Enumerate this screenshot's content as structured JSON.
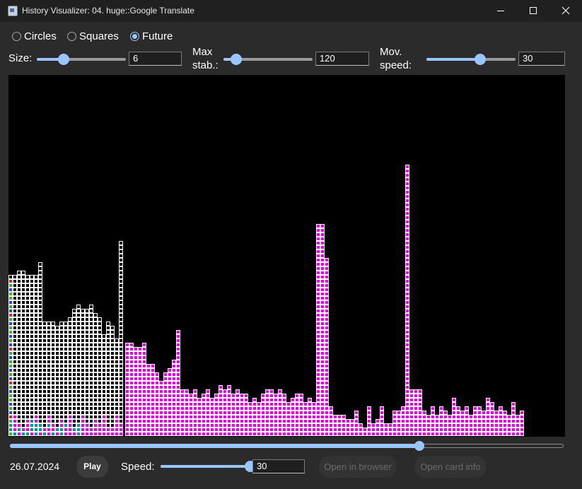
{
  "window": {
    "title": "History Visualizer: 04. huge::Google Translate",
    "icon": "app-icon"
  },
  "controls": {
    "modes": [
      {
        "label": "Circles",
        "selected": false
      },
      {
        "label": "Squares",
        "selected": false
      },
      {
        "label": "Future",
        "selected": true
      }
    ],
    "size": {
      "label": "Size:",
      "value": "6",
      "slider_fraction": 0.3
    },
    "max_stab": {
      "label_line1": "Max",
      "label_line2": "stab.:",
      "value": "120",
      "slider_fraction": 0.14
    },
    "mov_speed": {
      "label_line1": "Mov.",
      "label_line2": "speed:",
      "value": "30",
      "slider_fraction": 0.6
    }
  },
  "visualization": {
    "colors": {
      "cleared": "#ee00ee",
      "untouched": "#000000",
      "teal": "#009999",
      "green": "#33bb33",
      "blue": "#2244ff",
      "red": "#ee2222"
    },
    "columns_left": [
      38,
      38,
      39,
      39,
      38,
      38,
      38,
      41,
      27,
      27,
      27,
      26,
      27,
      27,
      28,
      30,
      31,
      30,
      30,
      31,
      29,
      28,
      24,
      27,
      26,
      23,
      46
    ],
    "columns_right": [
      22,
      22,
      21,
      21,
      22,
      17,
      17,
      15,
      13,
      15,
      16,
      18,
      25,
      11,
      11,
      10,
      11,
      9,
      10,
      11,
      9,
      10,
      12,
      11,
      12,
      10,
      11,
      10,
      10,
      8,
      9,
      8,
      10,
      11,
      11,
      10,
      11,
      10,
      8,
      9,
      10,
      10,
      8,
      9,
      8,
      50,
      50,
      42,
      7,
      5,
      5,
      5,
      4,
      4,
      6,
      3,
      2,
      7,
      3,
      4,
      7,
      3,
      3,
      6,
      6,
      7,
      64,
      11,
      11,
      11,
      6,
      5,
      7,
      5,
      7,
      6,
      5,
      9,
      7,
      6,
      7,
      5,
      7,
      7,
      6,
      9,
      8,
      6,
      7,
      6,
      5,
      8,
      5,
      6
    ]
  },
  "timeline": {
    "fraction": 0.74
  },
  "playback": {
    "date": "26.07.2024",
    "play_label": "Play",
    "speed_label": "Speed:",
    "speed_value": "30",
    "speed_fraction": 1.0,
    "open_browser_label": "Open in browser",
    "open_card_label": "Open card info"
  }
}
